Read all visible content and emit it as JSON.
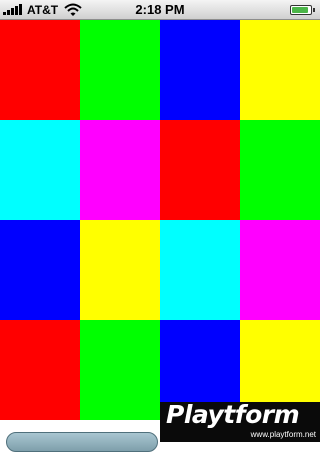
{
  "status_bar": {
    "carrier": "AT&T",
    "time": "2:18 PM",
    "wifi_icon": "wifi-icon",
    "signal_icon": "signal-bars-icon",
    "signal_bars": 5,
    "battery_icon": "battery-icon",
    "battery_level": 0.9
  },
  "grid": {
    "columns": 4,
    "rows": 4,
    "tiles": [
      {
        "color": "#ff0000"
      },
      {
        "color": "#00ff00"
      },
      {
        "color": "#0000ff"
      },
      {
        "color": "#ffff00"
      },
      {
        "color": "#00ffff"
      },
      {
        "color": "#ff00ff"
      },
      {
        "color": "#ff0000"
      },
      {
        "color": "#00ff00"
      },
      {
        "color": "#0000ff"
      },
      {
        "color": "#ffff00"
      },
      {
        "color": "#00ffff"
      },
      {
        "color": "#ff00ff"
      },
      {
        "color": "#ff0000"
      },
      {
        "color": "#00ff00"
      },
      {
        "color": "#0000ff"
      },
      {
        "color": "#ffff00"
      }
    ]
  },
  "watermark": {
    "logo": "Playtform",
    "url": "www.playtform.net"
  }
}
